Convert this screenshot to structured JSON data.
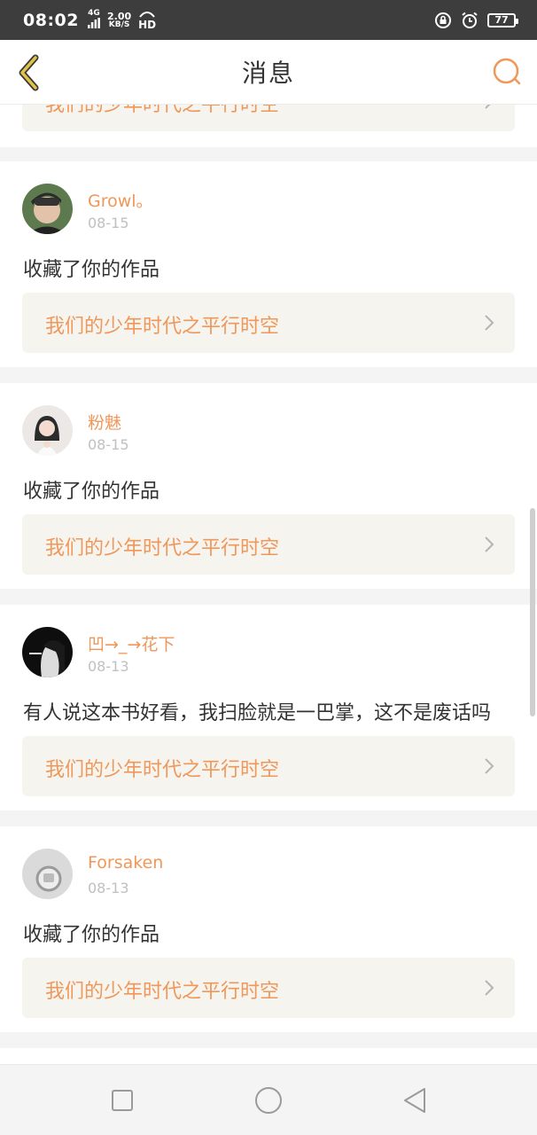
{
  "status_bar": {
    "time": "08:02",
    "network": "4G",
    "speed_value": "2.00",
    "speed_unit": "KB/S",
    "hd": "HD",
    "battery": "77"
  },
  "header": {
    "title": "消息"
  },
  "partial_top": {
    "book_title": "我们的少年时代之平行时空"
  },
  "messages": [
    {
      "name": "Growl。",
      "date": "08-15",
      "text": "收藏了你的作品",
      "book": "我们的少年时代之平行时空",
      "avatar_color": "#3b4a3a"
    },
    {
      "name": "粉魅",
      "date": "08-15",
      "text": "收藏了你的作品",
      "book": "我们的少年时代之平行时空",
      "avatar_color": "#e9e6e4"
    },
    {
      "name": "凹→_→花下",
      "date": "08-13",
      "text": "有人说这本书好看，我扫脸就是一巴掌，这不是废话吗",
      "book": "我们的少年时代之平行时空",
      "avatar_color": "#141414"
    },
    {
      "name": "Forsaken",
      "date": "08-13",
      "text": "收藏了你的作品",
      "book": "我们的少年时代之平行时空",
      "avatar_color": "#d8d8d8"
    }
  ],
  "colors": {
    "accent": "#f0975a",
    "back_arrow": "#c9a227",
    "card_bg": "#f5f4ef"
  }
}
